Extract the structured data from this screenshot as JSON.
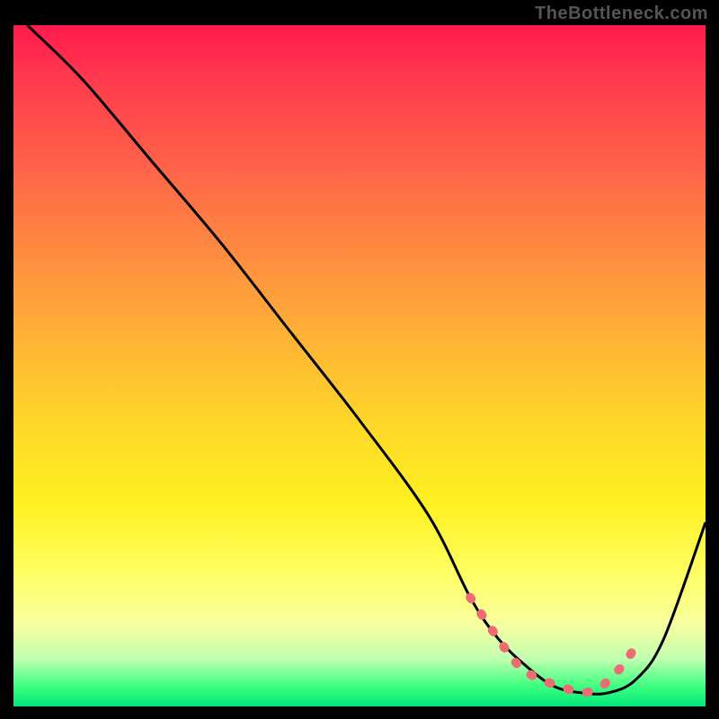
{
  "watermark": "TheBottleneck.com",
  "colors": {
    "background": "#000000",
    "curve": "#000000",
    "dots": "#ef6b74",
    "watermark": "#555555"
  },
  "chart_data": {
    "type": "line",
    "title": "",
    "xlabel": "",
    "ylabel": "",
    "xlim": [
      0,
      100
    ],
    "ylim": [
      0,
      100
    ],
    "series": [
      {
        "name": "bottleneck-curve",
        "x": [
          2,
          10,
          20,
          30,
          40,
          50,
          60,
          66,
          70,
          74,
          78,
          82,
          86,
          90,
          94,
          100
        ],
        "y": [
          100,
          92,
          80,
          68,
          55,
          42,
          28,
          16,
          10,
          6,
          3,
          2,
          2,
          4,
          10,
          27
        ]
      }
    ],
    "highlight_region": {
      "name": "optimal-zone-dots",
      "x": [
        66,
        70,
        73,
        76,
        79,
        82,
        85,
        88,
        90
      ],
      "y": [
        16,
        10,
        6,
        4,
        3,
        2,
        3,
        6,
        9
      ]
    }
  }
}
